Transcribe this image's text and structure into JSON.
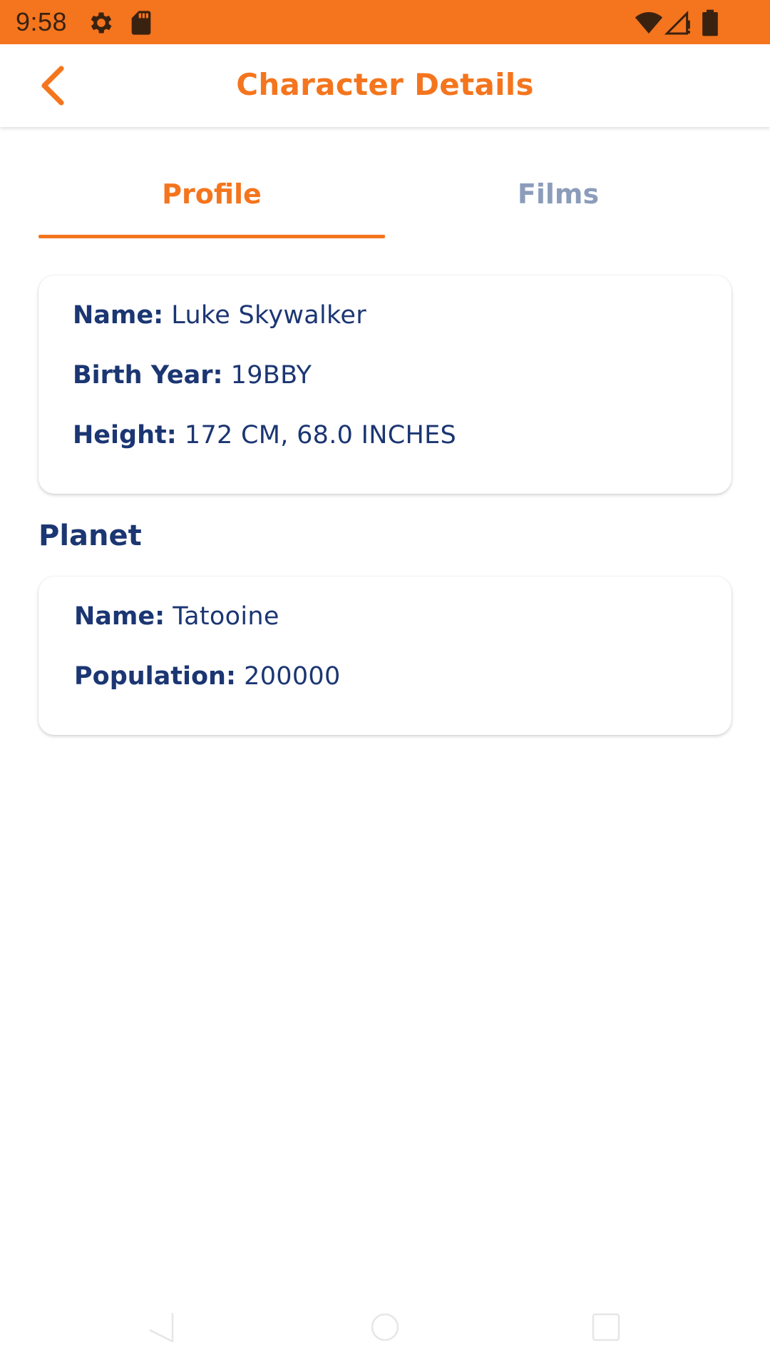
{
  "status_bar": {
    "time": "9:58",
    "left_icons": [
      "settings-icon",
      "sd-card-icon"
    ],
    "right_icons": [
      "wifi-icon",
      "cell-signal-icon",
      "battery-icon"
    ],
    "background": "#F4751E"
  },
  "app_bar": {
    "title": "Character Details",
    "back_icon": "chevron-left-icon"
  },
  "tabs": [
    {
      "label": "Profile",
      "active": true
    },
    {
      "label": "Films",
      "active": false
    }
  ],
  "profile": {
    "name_label": "Name:",
    "name_value": "Luke Skywalker",
    "birth_year_label": "Birth Year:",
    "birth_year_value": "19BBY",
    "height_label": "Height:",
    "height_value": "172 CM, 68.0 INCHES"
  },
  "planet": {
    "heading": "Planet",
    "name_label": "Name:",
    "name_value": "Tatooine",
    "population_label": "Population:",
    "population_value": "200000"
  },
  "nav_bar": {
    "icons": [
      "back-triangle-icon",
      "home-circle-icon",
      "recents-square-icon"
    ]
  },
  "colors": {
    "accent": "#F4751E",
    "text_primary": "#1B3672",
    "tab_inactive": "#8C9DBB"
  }
}
